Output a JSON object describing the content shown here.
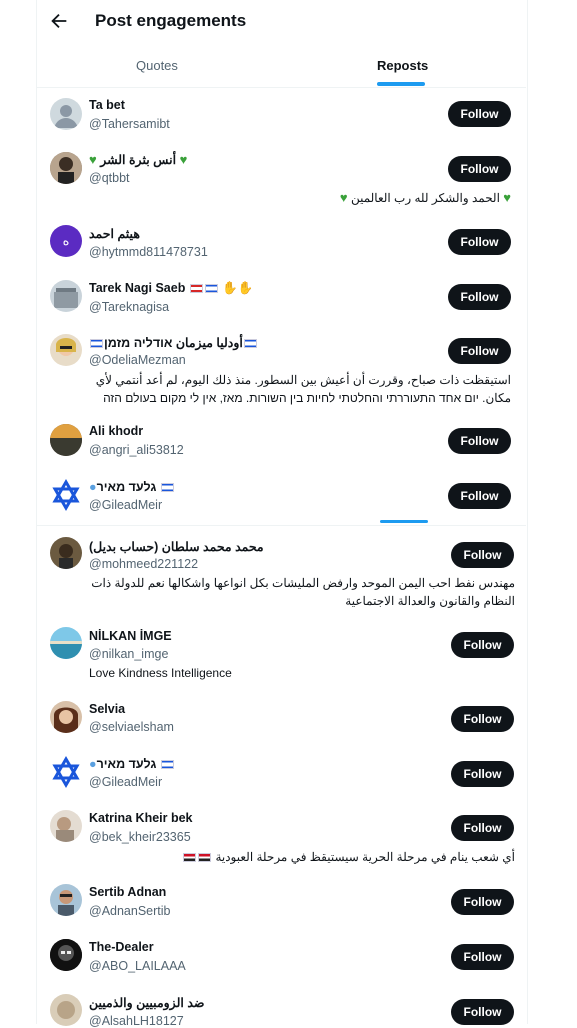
{
  "header": {
    "title": "Post engagements"
  },
  "tabs": [
    {
      "label": "Quotes",
      "active": false
    },
    {
      "label": "Reposts",
      "active": true
    }
  ],
  "follow_label": "Follow",
  "users": [
    {
      "name": "Ta bet",
      "handle": "@Tahersamibt",
      "bio": []
    },
    {
      "name": "أنس بثرة الشر",
      "handle": "@qtbbt",
      "bio": [
        "الحمد والشكر لله رب العالمين"
      ]
    },
    {
      "name": "هيثم احمد",
      "handle": "@hytmmd811478731",
      "bio": []
    },
    {
      "name": "Tarek Nagi Saeb",
      "handle": "@Tareknagisa",
      "bio": []
    },
    {
      "name": "أودليا ميزمان אודליה מזמן",
      "handle": "@OdeliaMezman",
      "bio": [
        "استيقظت ذات صباح، وقررت أن أعيش بين السطور. منذ ذلك اليوم، لم أعد أنتمي لأي",
        "مكان. יום אחד התעוררתי והחלטתי לחיות בין השורות. מאז, אין לי מקום בעולם הזה"
      ]
    },
    {
      "name": "Ali khodr",
      "handle": "@angri_ali53812",
      "bio": []
    },
    {
      "name": "גלעד מאיר",
      "handle": "@GileadMeir",
      "bio": []
    },
    {
      "name": "محمد محمد سلطان (حساب بديل)",
      "handle": "@mohmeed221122",
      "bio": [
        "مهندس نفط احب اليمن الموحد وارفض المليشات بكل انواعها واشكالها نعم للدولة ذات",
        "النظام والقانون والعدالة الاجتماعية"
      ]
    },
    {
      "name": "NİLKAN İMGE",
      "handle": "@nilkan_imge",
      "bio": [
        "Love Kindness Intelligence"
      ]
    },
    {
      "name": "Selvia",
      "handle": "@selviaelsham",
      "bio": []
    },
    {
      "name": "גלעד מאיר",
      "handle": "@GileadMeir",
      "bio": []
    },
    {
      "name": "Katrina Kheir bek",
      "handle": "@bek_kheir23365",
      "bio": [
        "أي شعب ينام في مرحلة الحرية سيستيقظ في مرحلة العبودية"
      ]
    },
    {
      "name": "Sertib Adnan",
      "handle": "@AdnanSertib",
      "bio": []
    },
    {
      "name": "The-Dealer",
      "handle": "@ABO_LAILAAA",
      "bio": []
    },
    {
      "name": "ضد الزومبيين والذميين",
      "handle": "@AlsahLH18127",
      "bio": []
    }
  ],
  "avatars": [
    {
      "icon": "default-person-avatar",
      "color": "#cfd9de"
    },
    {
      "icon": "photo-avatar",
      "color": "#8a7a6a"
    },
    {
      "icon": "letter-avatar",
      "letter": "ه",
      "color": "#5b2bc2"
    },
    {
      "icon": "building-photo-avatar",
      "color": "#9aa6b0"
    },
    {
      "icon": "photo-avatar",
      "color": "#d8c6a8"
    },
    {
      "icon": "landscape-photo-avatar",
      "color": "#b07a30"
    },
    {
      "icon": "star-of-david-avatar",
      "color": "#1a56db"
    },
    {
      "icon": "photo-avatar",
      "color": "#4a3b2a"
    },
    {
      "icon": "landscape-photo-avatar",
      "color": "#3a8fb7"
    },
    {
      "icon": "photo-avatar",
      "color": "#a66e4e"
    },
    {
      "icon": "star-of-david-avatar",
      "color": "#1a56db"
    },
    {
      "icon": "photo-avatar",
      "color": "#c9b8a8"
    },
    {
      "icon": "photo-avatar",
      "color": "#6b88a0"
    },
    {
      "icon": "photo-avatar",
      "color": "#111111"
    },
    {
      "icon": "photo-avatar",
      "color": "#d9cdb8"
    }
  ]
}
